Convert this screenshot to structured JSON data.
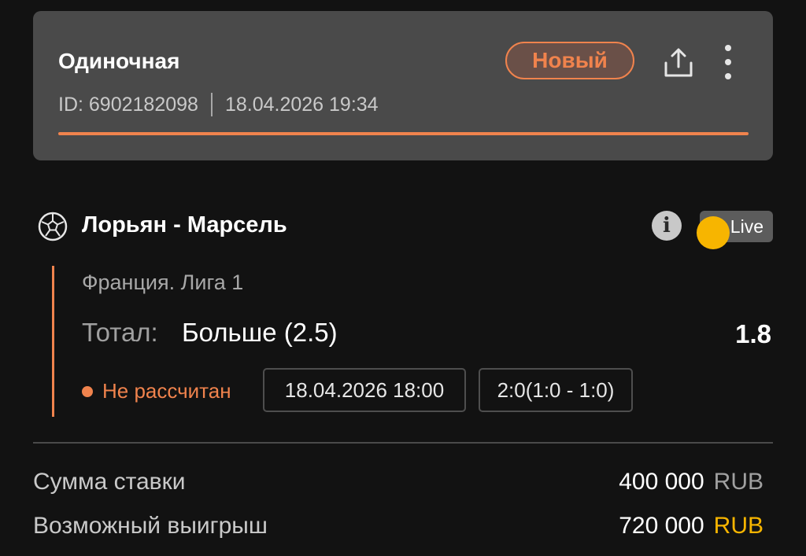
{
  "card": {
    "bet_type": "Одиночная",
    "id_text": "ID: 6902182098",
    "datetime": "18.04.2026 19:34",
    "status": "Новый",
    "icons": [
      "share-icon",
      "more-vertical-icon"
    ]
  },
  "event": {
    "sport_icon": "soccer-ball-icon",
    "match": "Лорьян - Марсель",
    "info_icon": "info-icon",
    "live_label": "Live",
    "league": "Франция. Лига 1",
    "market_label": "Тотал:",
    "market_value": "Больше (2.5)",
    "odds": "1.8",
    "settlement": "Не рассчитан",
    "start_time": "18.04.2026 18:00",
    "score": "2:0(1:0 - 1:0)"
  },
  "summary": {
    "stake_label": "Сумма ставки",
    "stake_amount": "400 000",
    "stake_currency": "RUB",
    "win_label": "Возможный выигрыш",
    "win_amount": "720 000",
    "win_currency": "RUB"
  },
  "colors": {
    "accent": "#f0834d",
    "gold": "#f7b500",
    "background": "#121212",
    "card": "#4a4a4a"
  }
}
